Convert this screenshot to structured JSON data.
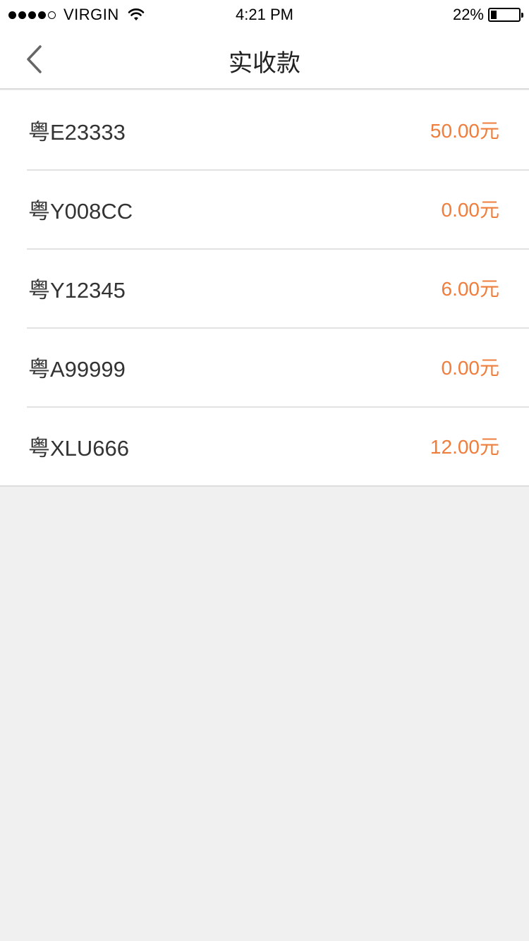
{
  "status_bar": {
    "carrier": "VIRGIN",
    "signal_bars_filled": 4,
    "signal_bars_total": 5,
    "time": "4:21 PM",
    "battery_percent": "22%",
    "battery_level": 0.22
  },
  "nav": {
    "title": "实收款",
    "back_icon": "chevron-left-icon"
  },
  "colors": {
    "amount": "#ef7d3c",
    "background": "#f0f0f0"
  },
  "items": [
    {
      "plate": "粤E23333",
      "amount": "50.00元"
    },
    {
      "plate": "粤Y008CC",
      "amount": "0.00元"
    },
    {
      "plate": "粤Y12345",
      "amount": "6.00元"
    },
    {
      "plate": "粤A99999",
      "amount": "0.00元"
    },
    {
      "plate": "粤XLU666",
      "amount": "12.00元"
    }
  ]
}
